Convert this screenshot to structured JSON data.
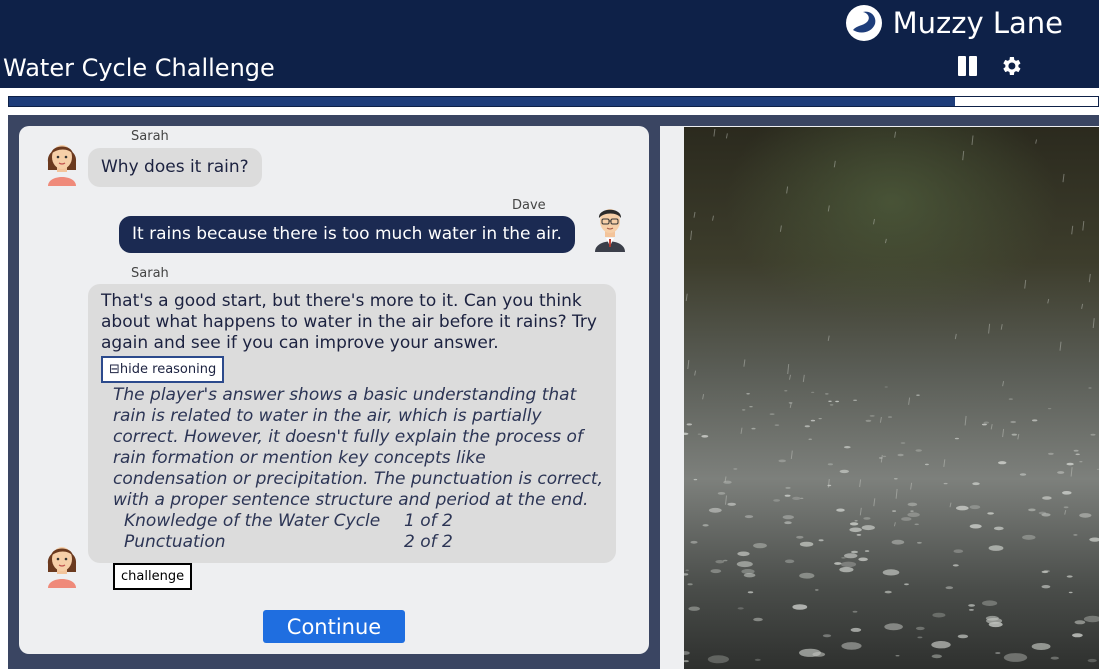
{
  "brand": {
    "name": "Muzzy Lane",
    "logo_icon": "muzzy-lane-logo-icon"
  },
  "header": {
    "title": "Water Cycle Challenge",
    "pause_icon": "pause-icon",
    "settings_icon": "gear-icon"
  },
  "progress": {
    "fraction": 0.869
  },
  "chat": {
    "messages": [
      {
        "speaker": "Sarah",
        "text": "Why does it rain?"
      },
      {
        "speaker": "Dave",
        "text": "It rains because there is too much water in the air."
      },
      {
        "speaker": "Sarah",
        "text": "That's a good start, but there's more to it. Can you think about what happens to water in the air before it rains? Try again and see if you can improve your answer.",
        "hide_reasoning_label": "hide reasoning",
        "reasoning": "The player's answer shows a basic understanding that rain is related to water in the air, which is partially correct. However, it doesn't fully explain the process of rain formation or mention key concepts like condensation or precipitation. The punctuation is correct, with a proper sentence structure and period at the end.",
        "rubric": [
          {
            "criterion": "Knowledge of the Water Cycle",
            "score": "1 of 2"
          },
          {
            "criterion": "Punctuation",
            "score": "2 of 2"
          }
        ],
        "challenge_label": "challenge"
      }
    ],
    "continue_label": "Continue"
  },
  "colors": {
    "navy": "#0e2148",
    "accent": "#1f6ee0",
    "stage": "#3a4562"
  }
}
